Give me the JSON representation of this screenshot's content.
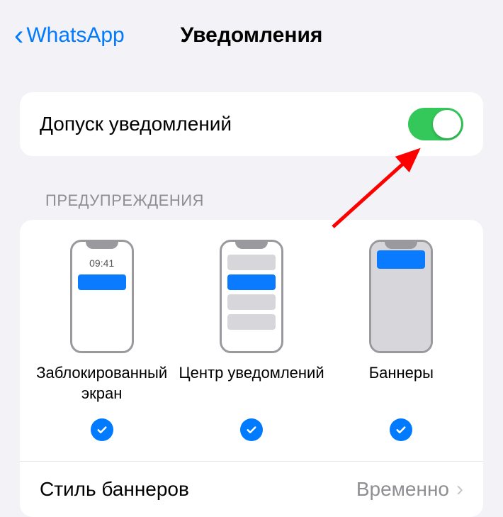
{
  "header": {
    "back_label": "WhatsApp",
    "title": "Уведомления"
  },
  "allow_notifications": {
    "label": "Допуск уведомлений",
    "enabled": true
  },
  "alerts": {
    "section_title": "ПРЕДУПРЕЖДЕНИЯ",
    "lock_time": "09:41",
    "options": [
      {
        "label": "Заблокированный\nэкран",
        "checked": true
      },
      {
        "label": "Центр уведомлений",
        "checked": true
      },
      {
        "label": "Баннеры",
        "checked": true
      }
    ]
  },
  "banner_style": {
    "label": "Стиль баннеров",
    "value": "Временно"
  }
}
